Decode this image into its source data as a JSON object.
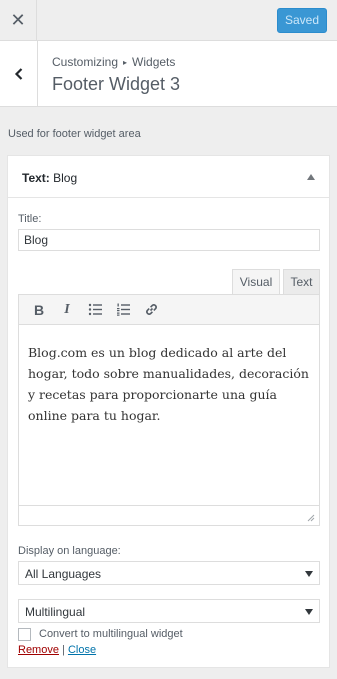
{
  "topbar": {
    "saved_label": "Saved"
  },
  "header": {
    "breadcrumb_root": "Customizing",
    "breadcrumb_section": "Widgets",
    "title": "Footer Widget 3"
  },
  "description": "Used for footer widget area",
  "widget": {
    "type_label": "Text:",
    "name": "Blog",
    "title_label": "Title:",
    "title_value": "Blog",
    "tabs": {
      "visual": "Visual",
      "text": "Text"
    },
    "toolbar_icons": [
      "bold-icon",
      "italic-icon",
      "bulleted-list-icon",
      "numbered-list-icon",
      "link-icon"
    ],
    "content": "Blog.com es un blog dedicado al arte del hogar, todo sobre manualidades, decoración y recetas para proporcionarte una guía online para tu hogar.",
    "language_label": "Display on language:",
    "language_value": "All Languages",
    "mode_value": "Multilingual",
    "convert_label": "Convert to multilingual widget",
    "remove_label": "Remove",
    "separator": "|",
    "close_label": "Close"
  },
  "colors": {
    "primary": "#3a97d4",
    "link": "#0073aa",
    "remove": "#a00000"
  }
}
